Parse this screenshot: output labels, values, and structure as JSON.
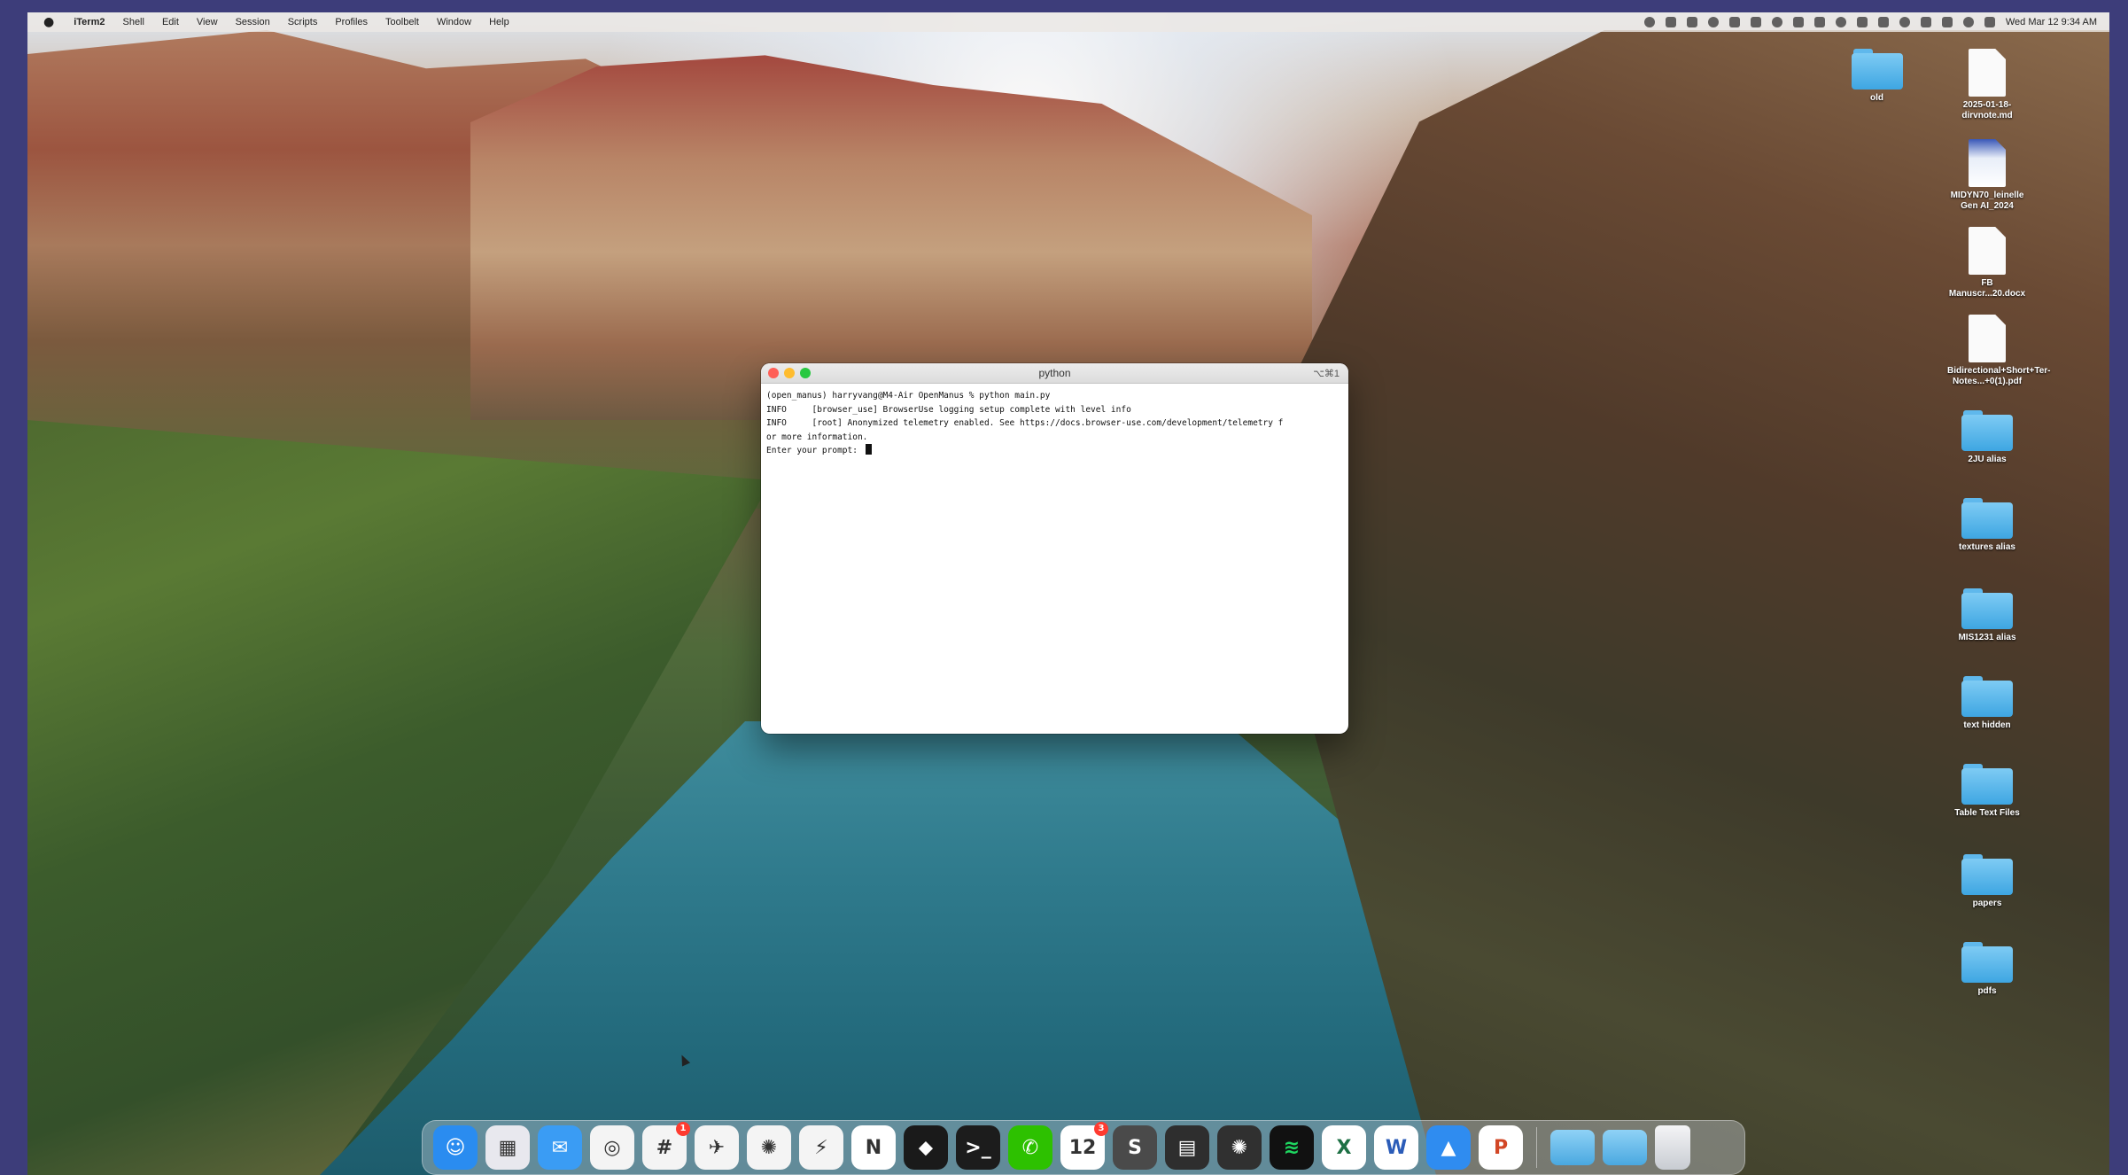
{
  "menubar": {
    "apple_icon": "apple-logo",
    "items": [
      "iTerm2",
      "Shell",
      "Edit",
      "View",
      "Session",
      "Scripts",
      "Profiles",
      "Toolbelt",
      "Window",
      "Help"
    ],
    "status_icons": [
      "record-icon",
      "circle-icon",
      "mic-icon",
      "b-icon",
      "wechat-icon",
      "slack-icon",
      "cloud-icon",
      "display-icon",
      "shazam-icon",
      "clock-icon",
      "network-icon",
      "volume-icon",
      "bluetooth-icon",
      "wifi-icon",
      "search-icon",
      "control-center-icon",
      "siri-icon"
    ],
    "clock": "Wed Mar 12 9:34 AM"
  },
  "terminal": {
    "title": "python",
    "shortcut": "⌥⌘1",
    "lines": [
      "(open_manus) harryvang@M4-Air OpenManus % python main.py",
      "INFO     [browser_use] BrowserUse logging setup complete with level info",
      "INFO     [root] Anonymized telemetry enabled. See https://docs.browser-use.com/development/telemetry f",
      "or more information.",
      "Enter your prompt: "
    ]
  },
  "desktop_icons": [
    {
      "label": "old",
      "type": "folder"
    },
    {
      "label": "2025-01-18-dirvnote.md",
      "type": "doc"
    },
    {
      "label": "MIDYN70_leinelle Gen AI_2024",
      "type": "image"
    },
    {
      "label": "FB Manuscr...20.docx",
      "type": "doc"
    },
    {
      "label": "Bidirectional+Short+Ter-Notes...+0(1).pdf",
      "type": "doc"
    },
    {
      "label": "2JU alias",
      "type": "folder"
    },
    {
      "label": "textures alias",
      "type": "folder"
    },
    {
      "label": "MIS1231 alias",
      "type": "folder"
    },
    {
      "label": "text hidden",
      "type": "folder"
    },
    {
      "label": "Table Text Files",
      "type": "folder"
    },
    {
      "label": "papers",
      "type": "folder"
    },
    {
      "label": "pdfs",
      "type": "folder"
    }
  ],
  "dock": {
    "apps": [
      {
        "name": "Finder",
        "icon": "finder-icon",
        "color": "#2a8cf0",
        "glyph": "☺"
      },
      {
        "name": "Launchpad",
        "icon": "launchpad-icon",
        "color": "#e8e8ee",
        "glyph": "▦"
      },
      {
        "name": "Mail",
        "icon": "mail-icon",
        "color": "#3a9cf4",
        "glyph": "✉"
      },
      {
        "name": "Chrome",
        "icon": "chrome-icon",
        "color": "#f4f4f4",
        "glyph": "◎"
      },
      {
        "name": "Slack",
        "icon": "slack-icon",
        "color": "#f4f4f4",
        "glyph": "#",
        "badge": "1"
      },
      {
        "name": "Mimestream",
        "icon": "mimestream-icon",
        "color": "#f4f4f4",
        "glyph": "✈"
      },
      {
        "name": "ChatGPT",
        "icon": "chatgpt-icon",
        "color": "#f4f4f4",
        "glyph": "✺"
      },
      {
        "name": "Perplexity",
        "icon": "perplexity-icon",
        "color": "#f4f4f4",
        "glyph": "⚡"
      },
      {
        "name": "Notion",
        "icon": "notion-icon",
        "color": "#ffffff",
        "glyph": "N"
      },
      {
        "name": "Cursor",
        "icon": "cursor-app-icon",
        "color": "#1a1a1a",
        "glyph": "⬥"
      },
      {
        "name": "Terminal",
        "icon": "terminal-icon",
        "color": "#1c1c1c",
        "glyph": ">_"
      },
      {
        "name": "WeChat",
        "icon": "wechat-icon",
        "color": "#2dc100",
        "glyph": "✆"
      },
      {
        "name": "Calendar",
        "icon": "calendar-icon",
        "color": "#ffffff",
        "glyph": "12",
        "badge": "3"
      },
      {
        "name": "Sublime Text",
        "icon": "sublime-icon",
        "color": "#4a4a4a",
        "glyph": "S"
      },
      {
        "name": "Calculator",
        "icon": "calculator-icon",
        "color": "#2e2e2e",
        "glyph": "▤"
      },
      {
        "name": "OpenAI",
        "icon": "openai-icon",
        "color": "#303030",
        "glyph": "✺"
      },
      {
        "name": "Spotify",
        "icon": "spotify-icon",
        "color": "#111111",
        "glyph": "≋"
      },
      {
        "name": "Excel",
        "icon": "excel-icon",
        "color": "#ffffff",
        "glyph": "X"
      },
      {
        "name": "Word",
        "icon": "word-icon",
        "color": "#ffffff",
        "glyph": "W"
      },
      {
        "name": "Keynote",
        "icon": "keynote-icon",
        "color": "#2f8cf0",
        "glyph": "▲"
      },
      {
        "name": "PowerPoint",
        "icon": "powerpoint-icon",
        "color": "#ffffff",
        "glyph": "P"
      }
    ],
    "right": [
      {
        "name": "Downloads folder",
        "icon": "downloads-folder-icon"
      },
      {
        "name": "Applications folder",
        "icon": "applications-folder-icon"
      },
      {
        "name": "Trash",
        "icon": "trash-icon"
      }
    ]
  }
}
